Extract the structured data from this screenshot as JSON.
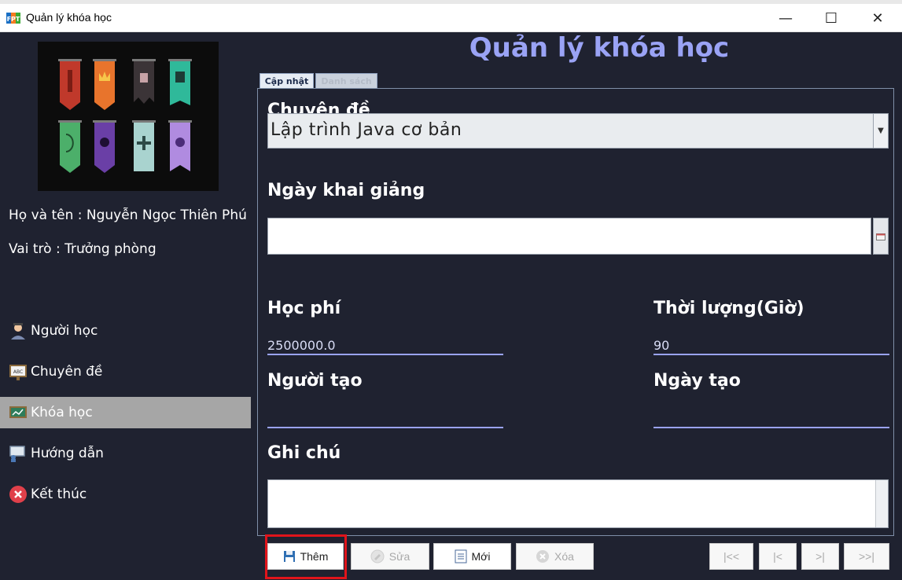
{
  "window": {
    "title": "Quản lý khóa học",
    "minimize_glyph": "—",
    "maximize_glyph": "☐",
    "close_glyph": "✕"
  },
  "sidebar": {
    "user_line": "Họ và tên : Nguyễn Ngọc Thiên Phú",
    "role_line": "Vai trò : Trưởng phòng",
    "menu": [
      {
        "label": "Người học",
        "icon": "student-icon",
        "active": false
      },
      {
        "label": "Chuyên đề",
        "icon": "board-icon",
        "active": false
      },
      {
        "label": "Khóa học",
        "icon": "chart-board-icon",
        "active": true
      },
      {
        "label": "Hướng dẫn",
        "icon": "presentation-icon",
        "active": false
      },
      {
        "label": "Kết thúc",
        "icon": "close-circle-icon",
        "active": false
      }
    ]
  },
  "main": {
    "heading": "Quản lý khóa học",
    "tabs": [
      {
        "label": "Cập nhật",
        "selected": true
      },
      {
        "label": "Danh sách",
        "selected": false
      }
    ],
    "form": {
      "chuyen_de_label": "Chuyên đề",
      "chuyen_de_value": "Lập trình Java cơ bản",
      "ngay_khai_giang_label": "Ngày khai giảng",
      "ngay_khai_giang_value": "",
      "hoc_phi_label": "Học phí",
      "hoc_phi_value": "2500000.0",
      "thoi_luong_label": "Thời lượng(Giờ)",
      "thoi_luong_value": "90",
      "nguoi_tao_label": "Người tạo",
      "nguoi_tao_value": "",
      "ngay_tao_label": "Ngày tạo",
      "ngay_tao_value": "",
      "ghi_chu_label": "Ghi chú",
      "ghi_chu_value": ""
    },
    "buttons": {
      "them": "Thêm",
      "sua": "Sửa",
      "moi": "Mới",
      "xoa": "Xóa",
      "first": "|<<",
      "prev": "|<",
      "next": ">|",
      "last": ">>|"
    }
  },
  "colors": {
    "background": "#1f2230",
    "heading": "#9aa3f5",
    "active_menu": "#a6a6a6",
    "highlight": "#e0141b"
  }
}
